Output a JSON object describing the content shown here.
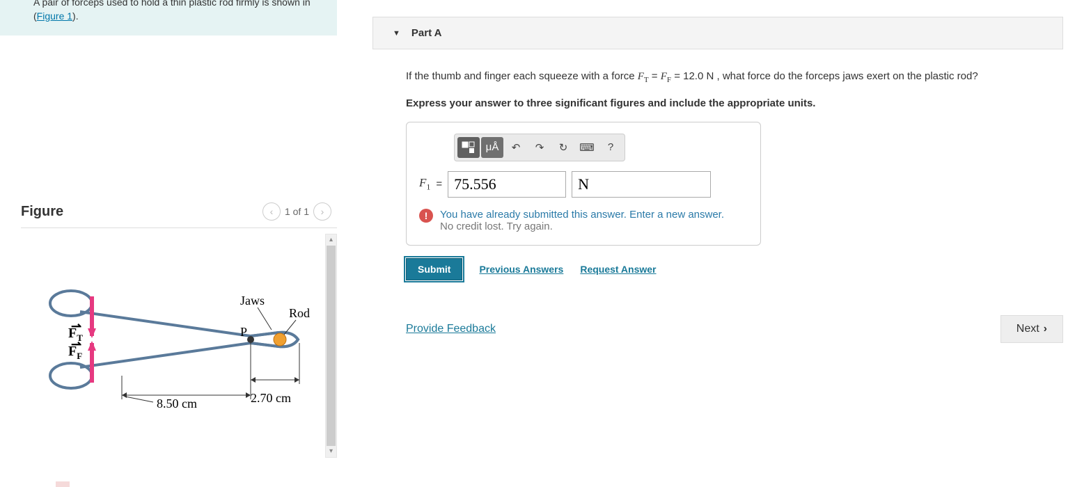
{
  "intro": {
    "text_before_link": "A pair of forceps used to hold a thin plastic rod firmly is shown in (",
    "link_text": "Figure 1",
    "text_after_link": ")."
  },
  "figure": {
    "title": "Figure",
    "pager": "1 of 1",
    "labels": {
      "jaws": "Jaws",
      "rod": "Rod",
      "pivot": "P",
      "ft": "F",
      "ft_sub": "T",
      "ff": "F",
      "ff_sub": "F",
      "dim1": "8.50 cm",
      "dim2": "2.70 cm"
    }
  },
  "part": {
    "label": "Part A",
    "question_before": "If the thumb and finger each squeeze with a force ",
    "ft_var": "F",
    "ft_sub": "T",
    "eq1": " = ",
    "ff_var": "F",
    "ff_sub": "F",
    "eq2": " = 12.0  N ",
    "question_after": ", what force do the forceps jaws exert on the plastic rod?",
    "instruction": "Express your answer to three significant figures and include the appropriate units.",
    "toolbar": {
      "templates": "▫▫",
      "units": "μÅ",
      "undo": "↶",
      "redo": "↷",
      "reset": "↻",
      "keyboard": "⌨",
      "help": "?"
    },
    "answer": {
      "var": "F",
      "sub": "1",
      "eq": " = ",
      "value": "75.556",
      "unit": "N"
    },
    "feedback": {
      "icon": "!",
      "line1": "You have already submitted this answer. Enter a new answer.",
      "line2": "No credit lost. Try again."
    },
    "actions": {
      "submit": "Submit",
      "previous": "Previous Answers",
      "request": "Request Answer"
    }
  },
  "footer": {
    "feedback": "Provide Feedback",
    "next": "Next"
  }
}
